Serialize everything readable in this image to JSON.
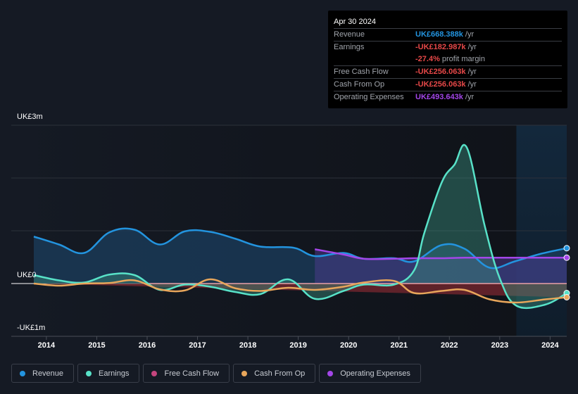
{
  "tooltip": {
    "date": "Apr 30 2024",
    "rows": [
      {
        "label": "Revenue",
        "value": "UK£668.388k",
        "unit": "/yr",
        "color": "#2394df"
      },
      {
        "label": "Earnings",
        "value": "-UK£182.987k",
        "unit": "/yr",
        "color": "#e64848"
      },
      {
        "label": "",
        "value": "-27.4%",
        "unit": "profit margin",
        "color": "#e64848"
      },
      {
        "label": "Free Cash Flow",
        "value": "-UK£256.063k",
        "unit": "/yr",
        "color": "#e64848"
      },
      {
        "label": "Cash From Op",
        "value": "-UK£256.063k",
        "unit": "/yr",
        "color": "#e64848"
      },
      {
        "label": "Operating Expenses",
        "value": "UK£493.643k",
        "unit": "/yr",
        "color": "#a346e8"
      }
    ]
  },
  "chart_data": {
    "type": "area",
    "title": "",
    "xlabel": "",
    "ylabel": "",
    "y_tick_labels": [
      {
        "value": 3,
        "label": "UK£3m"
      },
      {
        "value": 0,
        "label": "UK£0"
      },
      {
        "value": -1,
        "label": "-UK£1m"
      }
    ],
    "ylim": [
      -1,
      3
    ],
    "xlim": [
      2013.75,
      2024.33
    ],
    "x_tick_labels": [
      "2014",
      "2015",
      "2016",
      "2017",
      "2018",
      "2019",
      "2020",
      "2021",
      "2022",
      "2023",
      "2024"
    ],
    "forecast_region_start": 2023.33,
    "grid": true,
    "legend_position": "bottom",
    "series": [
      {
        "name": "Revenue",
        "color": "#2394df",
        "x": [
          2013.75,
          2014.25,
          2014.75,
          2015.25,
          2015.75,
          2016.25,
          2016.75,
          2017.25,
          2017.75,
          2018.25,
          2018.9,
          2019.33,
          2019.9,
          2020.3,
          2020.9,
          2021.3,
          2021.85,
          2022.3,
          2022.8,
          2023.3,
          2023.8,
          2024.33
        ],
        "y": [
          0.89,
          0.74,
          0.58,
          0.97,
          1.02,
          0.74,
          0.99,
          0.98,
          0.85,
          0.7,
          0.68,
          0.52,
          0.58,
          0.47,
          0.48,
          0.42,
          0.73,
          0.66,
          0.3,
          0.42,
          0.56,
          0.67
        ]
      },
      {
        "name": "Earnings",
        "color": "#58e2c8",
        "x": [
          2013.75,
          2014.25,
          2014.75,
          2015.25,
          2015.75,
          2016.25,
          2016.75,
          2017.25,
          2017.75,
          2018.25,
          2018.8,
          2019.33,
          2019.9,
          2020.3,
          2020.9,
          2021.3,
          2021.5,
          2021.85,
          2022.1,
          2022.35,
          2022.7,
          2023.0,
          2023.33,
          2023.9,
          2024.33
        ],
        "y": [
          0.16,
          0.06,
          0.02,
          0.17,
          0.16,
          -0.12,
          -0.02,
          -0.06,
          -0.16,
          -0.2,
          0.08,
          -0.29,
          -0.14,
          -0.02,
          -0.02,
          0.25,
          0.95,
          1.92,
          2.25,
          2.57,
          1.1,
          0.1,
          -0.42,
          -0.4,
          -0.18
        ]
      },
      {
        "name": "Free Cash Flow",
        "color": "#c4457e",
        "x": [
          2013.75,
          2024.33
        ],
        "y": [
          0,
          -0.26
        ]
      },
      {
        "name": "Cash From Op",
        "color": "#e8a65b",
        "x": [
          2013.75,
          2014.25,
          2014.75,
          2015.25,
          2015.75,
          2016.25,
          2016.75,
          2017.25,
          2017.75,
          2018.25,
          2018.8,
          2019.33,
          2019.9,
          2020.3,
          2020.9,
          2021.3,
          2021.85,
          2022.3,
          2022.8,
          2023.33,
          2023.9,
          2024.33
        ],
        "y": [
          0.0,
          -0.04,
          0.0,
          0.01,
          0.06,
          -0.11,
          -0.13,
          0.08,
          -0.09,
          -0.14,
          -0.08,
          -0.12,
          -0.06,
          0.02,
          0.05,
          -0.18,
          -0.14,
          -0.12,
          -0.3,
          -0.36,
          -0.3,
          -0.26
        ]
      },
      {
        "name": "Operating Expenses",
        "color": "#a346e8",
        "x": [
          2019.33,
          2019.9,
          2020.3,
          2020.9,
          2021.3,
          2021.85,
          2022.3,
          2022.8,
          2023.33,
          2023.9,
          2024.33
        ],
        "y": [
          0.65,
          0.55,
          0.47,
          0.47,
          0.48,
          0.48,
          0.49,
          0.49,
          0.49,
          0.49,
          0.49
        ]
      }
    ]
  },
  "legend": [
    {
      "label": "Revenue",
      "color": "#2394df"
    },
    {
      "label": "Earnings",
      "color": "#58e2c8"
    },
    {
      "label": "Free Cash Flow",
      "color": "#c4457e"
    },
    {
      "label": "Cash From Op",
      "color": "#e8a65b"
    },
    {
      "label": "Operating Expenses",
      "color": "#a346e8"
    }
  ]
}
